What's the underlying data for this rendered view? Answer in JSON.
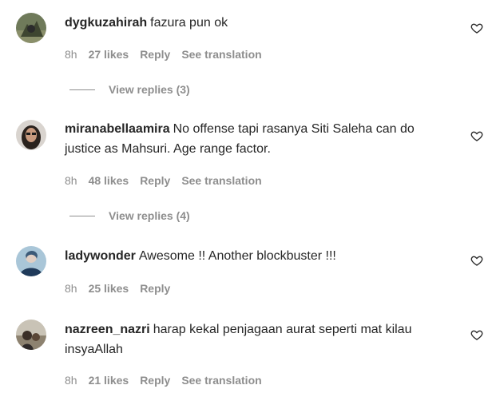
{
  "comments": [
    {
      "username": "dygkuzahirah",
      "text": "fazura pun ok",
      "time": "8h",
      "likes": "27 likes",
      "reply": "Reply",
      "translate": "See translation",
      "view_replies": "View replies (3)",
      "avatar": "avatar-dygkuzahirah"
    },
    {
      "username": "miranabellaamira",
      "text": "No offense tapi rasanya Siti Saleha can do justice as Mahsuri. Age range factor.",
      "time": "8h",
      "likes": "48 likes",
      "reply": "Reply",
      "translate": "See translation",
      "view_replies": "View replies (4)",
      "avatar": "avatar-miranabellaamira"
    },
    {
      "username": "ladywonder",
      "text": "Awesome !! Another blockbuster !!!",
      "time": "8h",
      "likes": "25 likes",
      "reply": "Reply",
      "avatar": "avatar-ladywonder"
    },
    {
      "username": "nazreen_nazri",
      "text": "harap kekal penjagaan aurat seperti mat kilau insyaAllah",
      "time": "8h",
      "likes": "21 likes",
      "reply": "Reply",
      "translate": "See translation",
      "avatar": "avatar-nazreen_nazri"
    }
  ],
  "icons": {
    "like": "heart-icon"
  },
  "colors": {
    "text": "#262626",
    "secondary": "#8e8e8e"
  }
}
